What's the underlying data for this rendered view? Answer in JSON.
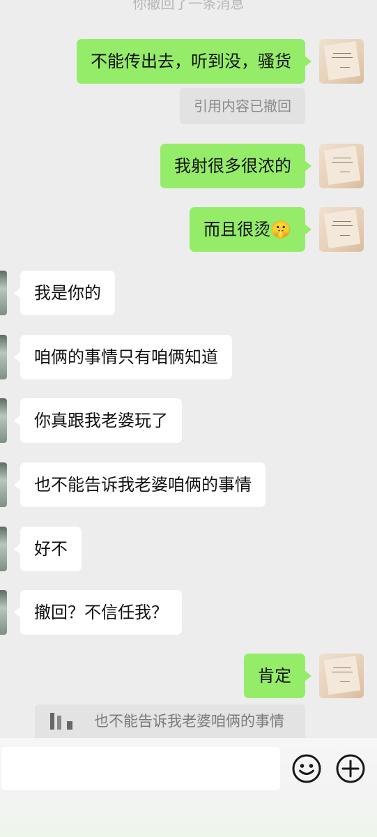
{
  "conversation": {
    "system_notice": "你撤回了一条消息",
    "messages": [
      {
        "side": "out",
        "text": "不能传出去，听到没，骚货"
      },
      {
        "side": "out",
        "text": "我射很多很浓的"
      },
      {
        "side": "out",
        "text": "而且很烫🤫"
      },
      {
        "side": "in",
        "text": "我是你的"
      },
      {
        "side": "in",
        "text": "咱俩的事情只有咱俩知道"
      },
      {
        "side": "in",
        "text": "你真跟我老婆玩了"
      },
      {
        "side": "in",
        "text": "也不能告诉我老婆咱俩的事情"
      },
      {
        "side": "in",
        "text": "好不"
      },
      {
        "side": "in",
        "text": "撤回？不信任我？"
      },
      {
        "side": "out",
        "text": "肯定"
      }
    ],
    "recalled_quote_label": "引用内容已撤回",
    "quote_preview": "也不能告诉我老婆咱俩的事情"
  },
  "input_bar": {
    "input_value": "",
    "emoji_icon": "smiley-face-icon",
    "plus_icon": "plus-circle-icon"
  },
  "colors": {
    "outgoing_bubble": "#95ec69",
    "incoming_bubble": "#ffffff",
    "background": "#ededed"
  }
}
